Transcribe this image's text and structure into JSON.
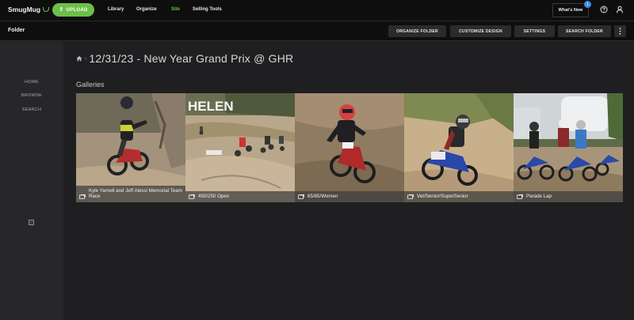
{
  "app": {
    "logo": "SmugMug"
  },
  "topbar": {
    "upload_label": "UPLOAD",
    "nav": [
      {
        "label": "Library",
        "active": false
      },
      {
        "label": "Organize",
        "active": false
      },
      {
        "label": "Site",
        "active": true
      },
      {
        "label": "Selling Tools",
        "active": false
      }
    ],
    "whats_new": "What's New",
    "whats_new_count": "1",
    "accent": "#6cc04a",
    "icons": [
      "help-icon",
      "user-icon"
    ]
  },
  "folderbar": {
    "title": "Folder",
    "buttons": [
      "ORGANIZE FOLDER",
      "CUSTOMIZE DESIGN",
      "SETTINGS",
      "SEARCH FOLDER"
    ],
    "menu_icon": "more-vertical-icon"
  },
  "sidebar": {
    "links": [
      "HOME",
      "BROWSE",
      "SEARCH"
    ]
  },
  "main": {
    "title": "12/31/23 - New Year Grand Prix @ GHR",
    "section_label": "Galleries",
    "galleries": [
      {
        "label": "Kyle Yarnell and Jeff Alessi Memorial Team Race"
      },
      {
        "label": "450/250 Open"
      },
      {
        "label": "65/85/Women"
      },
      {
        "label": "Vet/Senior/SuperSenior"
      },
      {
        "label": "Parade Lap"
      }
    ],
    "photo_sign_text": "HELEN"
  }
}
